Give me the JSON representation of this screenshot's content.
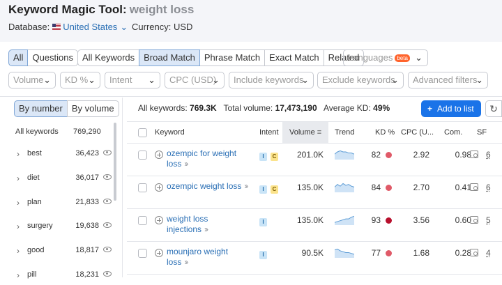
{
  "header": {
    "tool_title": "Keyword Magic Tool:",
    "query": "weight loss",
    "database_label": "Database:",
    "database_value": "United States",
    "currency": "Currency: USD"
  },
  "match_tabs": {
    "all": "All",
    "questions": "Questions",
    "all_keywords": "All Keywords",
    "broad_match": "Broad Match",
    "phrase_match": "Phrase Match",
    "exact_match": "Exact Match",
    "related": "Related",
    "selected": "Broad Match"
  },
  "languages": {
    "label": "Languages",
    "badge": "beta"
  },
  "filters": {
    "volume": "Volume",
    "kd": "KD %",
    "intent": "Intent",
    "cpc": "CPC (USD)",
    "include": "Include keywords",
    "exclude": "Exclude keywords",
    "advanced": "Advanced filters"
  },
  "sidebar": {
    "by_number": "By number",
    "by_volume": "By volume",
    "all_keywords_label": "All keywords",
    "all_keywords_count": "769,290",
    "groups": [
      {
        "name": "best",
        "count": "36,423"
      },
      {
        "name": "diet",
        "count": "36,017"
      },
      {
        "name": "plan",
        "count": "21,833"
      },
      {
        "name": "surgery",
        "count": "19,638"
      },
      {
        "name": "good",
        "count": "18,817"
      },
      {
        "name": "pill",
        "count": "18,231"
      }
    ]
  },
  "summary": {
    "all_keywords_label": "All keywords:",
    "all_keywords_value": "769.3K",
    "total_volume_label": "Total volume:",
    "total_volume_value": "17,473,190",
    "avg_kd_label": "Average KD:",
    "avg_kd_value": "49%"
  },
  "actions": {
    "add_to_list": "Add to list"
  },
  "table": {
    "headers": {
      "keyword": "Keyword",
      "intent": "Intent",
      "volume": "Volume",
      "trend": "Trend",
      "kd": "KD %",
      "cpc": "CPC (U...",
      "com": "Com.",
      "sf": "SF"
    },
    "rows": [
      {
        "keyword": "ozempic for weight loss",
        "intents": [
          "I",
          "C"
        ],
        "volume": "201.0K",
        "kd": "82",
        "cpc": "2.92",
        "com": "0.98",
        "sf": "6",
        "kd_color": "#e05a68",
        "trend": [
          5,
          7,
          8,
          7,
          7,
          6,
          6,
          5
        ]
      },
      {
        "keyword": "ozempic weight loss",
        "intents": [
          "I",
          "C"
        ],
        "volume": "135.0K",
        "kd": "84",
        "cpc": "2.70",
        "com": "0.41",
        "sf": "6",
        "kd_color": "#e05a68",
        "trend": [
          6,
          9,
          7,
          10,
          8,
          9,
          7,
          6
        ]
      },
      {
        "keyword": "weight loss injections",
        "intents": [
          "I"
        ],
        "volume": "135.0K",
        "kd": "93",
        "cpc": "3.56",
        "com": "0.60",
        "sf": "5",
        "kd_color": "#b8102d",
        "trend": [
          3,
          4,
          5,
          6,
          7,
          7,
          9,
          10
        ]
      },
      {
        "keyword": "mounjaro weight loss",
        "intents": [
          "I"
        ],
        "volume": "90.5K",
        "kd": "77",
        "cpc": "1.68",
        "com": "0.28",
        "sf": "4",
        "kd_color": "#e05a68",
        "trend": [
          9,
          10,
          8,
          7,
          6,
          6,
          5,
          4
        ]
      }
    ]
  },
  "colors": {
    "accent": "#1a73e8",
    "link": "#2a6fb5",
    "selected_tab": "#dbe7f7",
    "trend_fill": "#cfe3f6",
    "trend_line": "#5b9bd5"
  }
}
